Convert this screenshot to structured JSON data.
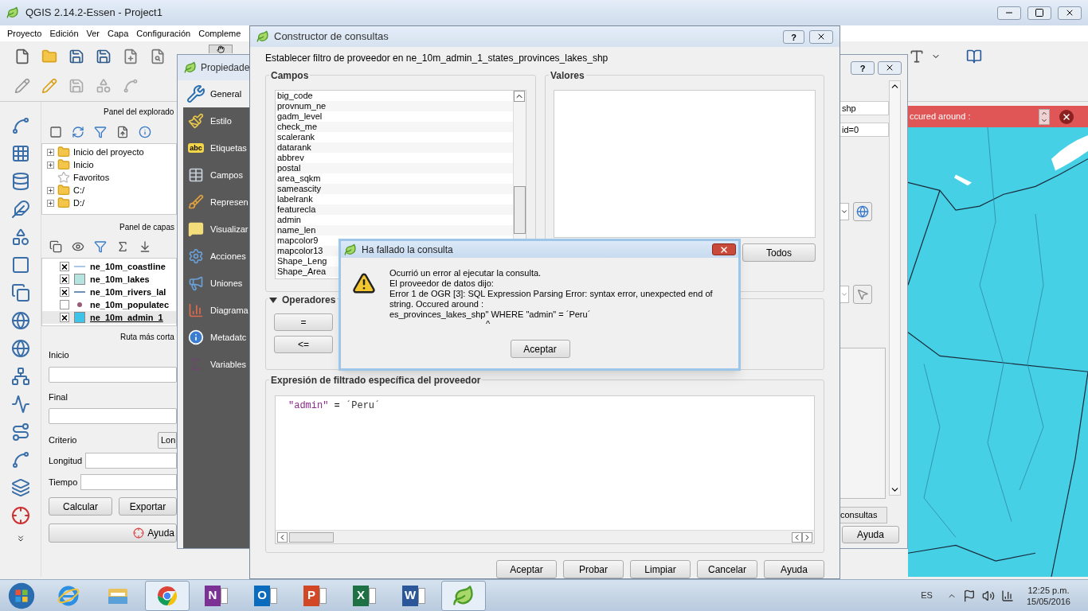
{
  "main_window": {
    "title": "QGIS 2.14.2-Essen - Project1",
    "menu": [
      "Proyecto",
      "Edición",
      "Ver",
      "Capa",
      "Configuración",
      "Compleme"
    ]
  },
  "browser_panel": {
    "title": "Panel del explorado",
    "items": [
      {
        "label": "Inicio del proyecto",
        "kind": "folder"
      },
      {
        "label": "Inicio",
        "kind": "folder"
      },
      {
        "label": "Favoritos",
        "kind": "favorites"
      },
      {
        "label": "C:/",
        "kind": "folder"
      },
      {
        "label": "D:/",
        "kind": "folder"
      }
    ]
  },
  "layers_panel": {
    "title": "Panel de capas",
    "layers": [
      {
        "name": "ne_10m_coastline",
        "checked": true,
        "selected": false,
        "kind": "line",
        "color": "#a9c8e8"
      },
      {
        "name": "ne_10m_lakes",
        "checked": true,
        "selected": false,
        "kind": "fill",
        "color": "#b5e3e0"
      },
      {
        "name": "ne_10m_rivers_lal",
        "checked": true,
        "selected": false,
        "kind": "line",
        "color": "#6d8fb8"
      },
      {
        "name": "ne_10m_populatec",
        "checked": false,
        "selected": false,
        "kind": "point",
        "color": "#9a5a7a"
      },
      {
        "name": "ne_10m_admin_1",
        "checked": true,
        "selected": true,
        "kind": "fill",
        "color": "#3ec4e8"
      }
    ]
  },
  "route_panel": {
    "title": "Ruta más corta",
    "start_label": "Inicio",
    "end_label": "Final",
    "criterion_label": "Criterio",
    "criterion_value": "Lon",
    "length_label": "Longitud",
    "time_label": "Tiempo",
    "buttons": [
      "Calcular",
      "Exportar"
    ],
    "help": "Ayuda"
  },
  "message_bar": {
    "text": "ccured around :"
  },
  "properties_window": {
    "title": "Propiedade",
    "help_button": "?",
    "sections": [
      {
        "label": "General",
        "kind": "general",
        "selected": true
      },
      {
        "label": "Estilo",
        "kind": "style",
        "selected": false
      },
      {
        "label": "Etiquetas",
        "kind": "labels",
        "badge": "abc",
        "selected": false
      },
      {
        "label": "Campos",
        "kind": "fields",
        "selected": false
      },
      {
        "label": "Represen",
        "kind": "rendering",
        "selected": false
      },
      {
        "label": "Visualizar",
        "kind": "display",
        "selected": false
      },
      {
        "label": "Acciones",
        "kind": "actions",
        "selected": false
      },
      {
        "label": "Uniones",
        "kind": "joins",
        "selected": false
      },
      {
        "label": "Diagrama",
        "kind": "diagrams",
        "selected": false
      },
      {
        "label": "Metadatc",
        "kind": "metadata",
        "selected": false
      },
      {
        "label": "Variables",
        "kind": "variables",
        "selected": false
      }
    ],
    "source_value": "shp",
    "encoding_value": "id=0",
    "query_button": "consultas",
    "help": "Ayuda"
  },
  "query_builder": {
    "title": "Constructor de consultas",
    "help_button": "?",
    "subtitle": "Establecer filtro de proveedor en ne_10m_admin_1_states_provinces_lakes_shp",
    "fields_title": "Campos",
    "fields": [
      "big_code",
      "provnum_ne",
      "gadm_level",
      "check_me",
      "scalerank",
      "datarank",
      "abbrev",
      "postal",
      "area_sqkm",
      "sameascity",
      "labelrank",
      "featurecla",
      "admin",
      "name_len",
      "mapcolor9",
      "mapcolor13",
      "Shape_Leng",
      "Shape_Area"
    ],
    "values_title": "Valores",
    "all_button": "Todos",
    "operators_title": "Operadores",
    "operators_expanded": true,
    "operators": [
      "=",
      "<="
    ],
    "expression_title": "Expresión de filtrado específica del proveedor",
    "expression": [
      {
        "text": "\"admin\"",
        "kind": "identifier"
      },
      {
        "text": " = ",
        "kind": "operator"
      },
      {
        "text": "´Peru´",
        "kind": "string"
      }
    ],
    "buttons": [
      "Aceptar",
      "Probar",
      "Limpiar",
      "Cancelar",
      "Ayuda"
    ]
  },
  "error_dialog": {
    "title": "Ha fallado la consulta",
    "lines": [
      "Ocurrió un error al ejecutar la consulta.",
      "El proveedor de datos dijo:",
      "Error 1 de OGR [3]: SQL Expression Parsing Error: syntax error, unexpected end of string. Occured around :",
      "es_provinces_lakes_shp\" WHERE \"admin\" = ´Peru´"
    ],
    "pointer": "^",
    "button": "Aceptar"
  },
  "taskbar": {
    "apps": [
      {
        "kind": "browser-e",
        "open": false
      },
      {
        "kind": "files",
        "open": false
      },
      {
        "kind": "chrome",
        "open": true
      },
      {
        "kind": "office",
        "letter": "N",
        "color": "#7b3294",
        "open": false
      },
      {
        "kind": "office",
        "letter": "O",
        "color": "#0b6cbd",
        "open": false
      },
      {
        "kind": "office",
        "letter": "P",
        "color": "#d24726",
        "open": false
      },
      {
        "kind": "office",
        "letter": "X",
        "color": "#1e7145",
        "open": false
      },
      {
        "kind": "office",
        "letter": "W",
        "color": "#2b579a",
        "open": false
      },
      {
        "kind": "qgis",
        "open": true
      }
    ],
    "language": "ES",
    "time": "12:25 p.m.",
    "date": "15/05/2016"
  }
}
